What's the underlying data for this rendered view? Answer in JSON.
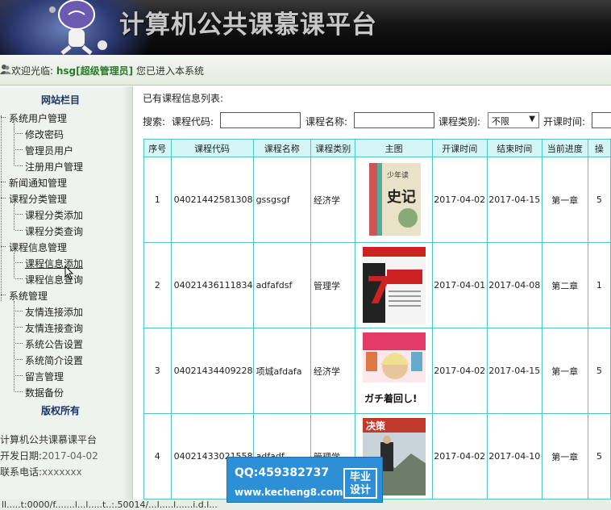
{
  "header": {
    "title": "计算机公共课慕课平台",
    "logo_icon": "mascot-logo-icon"
  },
  "welcome": {
    "prefix": "欢迎光临:",
    "username": "hsg[超级管理员]",
    "suffix": "您已进入本系统"
  },
  "sidebar": {
    "header": "网站栏目",
    "groups": [
      {
        "label": "系统用户管理",
        "children": [
          "修改密码",
          "管理员用户",
          "注册用户管理"
        ]
      },
      {
        "label": "新闻通知管理",
        "children": []
      },
      {
        "label": "课程分类管理",
        "children": [
          "课程分类添加",
          "课程分类查询"
        ]
      },
      {
        "label": "课程信息管理",
        "children": [
          "课程信息添加",
          "课程信息查询"
        ]
      },
      {
        "label": "系统管理",
        "children": [
          "友情连接添加",
          "友情连接查询",
          "系统公告设置",
          "系统简介设置",
          "留言管理",
          "数据备份"
        ]
      }
    ],
    "footer_header": "版权所有",
    "footer": {
      "name": "计算机公共课慕课平台",
      "date_label": "开发日期:",
      "date_value": "2017-04-02",
      "phone_label": "联系电话:",
      "phone_value": "xxxxxxx"
    }
  },
  "main": {
    "list_title": "已有课程信息列表:",
    "search": {
      "prefix": "搜索:",
      "code_label": "课程代码:",
      "name_label": "课程名称:",
      "type_label": "课程类别:",
      "type_value": "不限",
      "start_label": "开课时间:"
    },
    "table": {
      "columns": [
        "序号",
        "课程代码",
        "课程名称",
        "课程类别",
        "主图",
        "开课时间",
        "结束时间",
        "当前进度",
        "操"
      ],
      "rows": [
        {
          "no": "1",
          "code": "04021442581308",
          "name": "gssgsgf",
          "type": "经济学",
          "image": "史记",
          "start": "2017-04-02",
          "end": "2017-04-15",
          "progress": "第一章",
          "op": "5"
        },
        {
          "no": "2",
          "code": "04021436111834",
          "name": "adfafdsf",
          "type": "管理学",
          "image": "7",
          "start": "2017-04-01",
          "end": "2017-04-08",
          "progress": "第二章",
          "op": "1"
        },
        {
          "no": "3",
          "code": "04021434409228",
          "name": "项城afdafa",
          "type": "经济学",
          "image": "ガチ着回し!",
          "start": "2017-04-02",
          "end": "2017-04-15",
          "progress": "第一章",
          "op": "5"
        },
        {
          "no": "4",
          "code": "04021433021558",
          "name": "adfadf",
          "type": "管理学",
          "image": "决策",
          "start": "2017-04-02",
          "end": "2017-04-10",
          "progress": "第一章",
          "op": "5"
        }
      ]
    }
  },
  "watermark": {
    "qq": "QQ:459382737",
    "site": "www.kecheng8.com",
    "badge_line1": "毕业",
    "badge_line2": "设计"
  },
  "statusbar": "ll.....t:0000/f.......l...l.....t..:.50014/...l.....l......i.d.l..."
}
